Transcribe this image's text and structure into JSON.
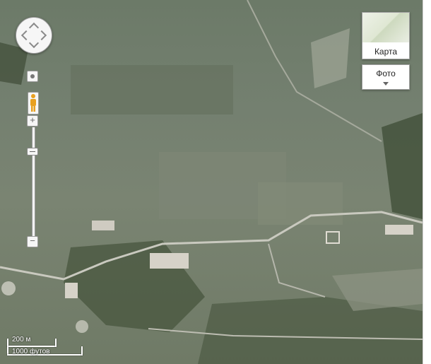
{
  "map_type_buttons": {
    "map_label": "Карта",
    "photo_label": "Фото"
  },
  "zoom": {
    "in_label": "+",
    "out_label": "−"
  },
  "scale": {
    "metric": "200 м",
    "imperial": "1000 футов"
  },
  "colors": {
    "terrain_dark": "#5f6c5a",
    "terrain_light": "#8b9383",
    "road": "#c9c9bf",
    "building": "#d6d2c8",
    "forest": "#3e4c36"
  },
  "icons": {
    "pan": "pan-control-icon",
    "pegman": "pegman-icon",
    "photo_dropdown": "chevron-down-icon"
  }
}
